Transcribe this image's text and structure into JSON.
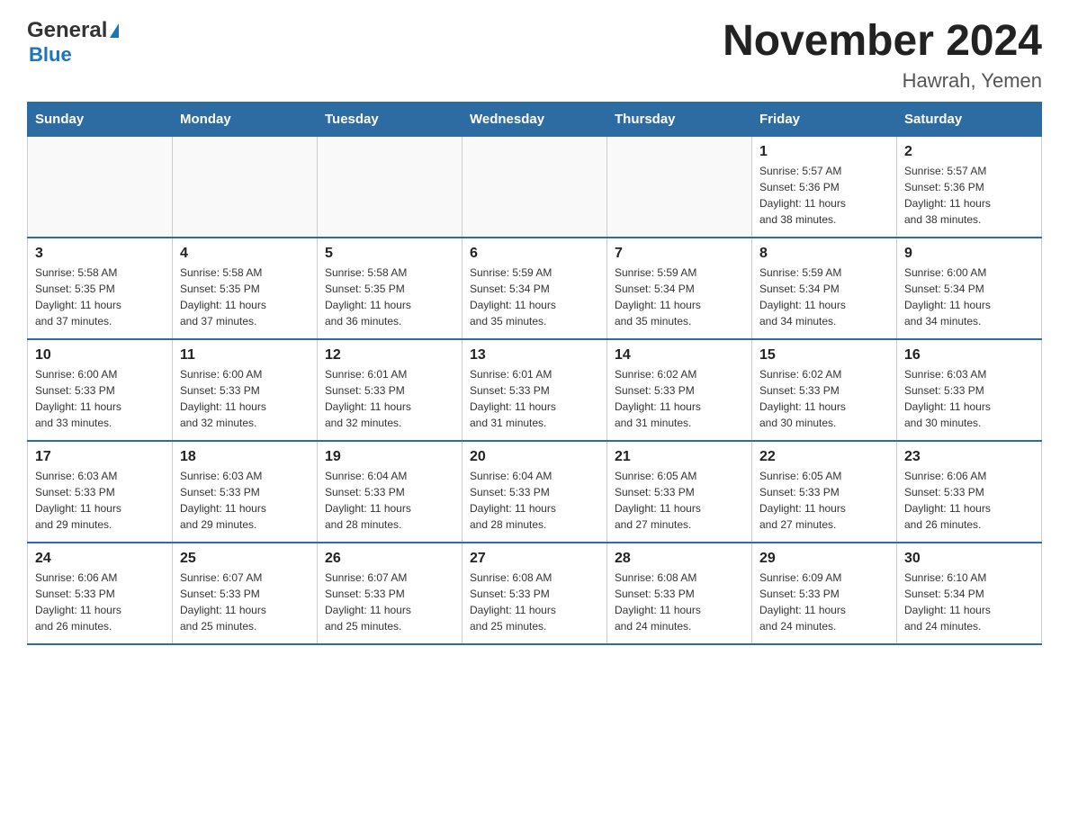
{
  "header": {
    "logo_general": "General",
    "logo_blue": "Blue",
    "title": "November 2024",
    "subtitle": "Hawrah, Yemen"
  },
  "days_header": [
    "Sunday",
    "Monday",
    "Tuesday",
    "Wednesday",
    "Thursday",
    "Friday",
    "Saturday"
  ],
  "weeks": [
    {
      "cells": [
        {
          "day": "",
          "info": ""
        },
        {
          "day": "",
          "info": ""
        },
        {
          "day": "",
          "info": ""
        },
        {
          "day": "",
          "info": ""
        },
        {
          "day": "",
          "info": ""
        },
        {
          "day": "1",
          "info": "Sunrise: 5:57 AM\nSunset: 5:36 PM\nDaylight: 11 hours\nand 38 minutes."
        },
        {
          "day": "2",
          "info": "Sunrise: 5:57 AM\nSunset: 5:36 PM\nDaylight: 11 hours\nand 38 minutes."
        }
      ]
    },
    {
      "cells": [
        {
          "day": "3",
          "info": "Sunrise: 5:58 AM\nSunset: 5:35 PM\nDaylight: 11 hours\nand 37 minutes."
        },
        {
          "day": "4",
          "info": "Sunrise: 5:58 AM\nSunset: 5:35 PM\nDaylight: 11 hours\nand 37 minutes."
        },
        {
          "day": "5",
          "info": "Sunrise: 5:58 AM\nSunset: 5:35 PM\nDaylight: 11 hours\nand 36 minutes."
        },
        {
          "day": "6",
          "info": "Sunrise: 5:59 AM\nSunset: 5:34 PM\nDaylight: 11 hours\nand 35 minutes."
        },
        {
          "day": "7",
          "info": "Sunrise: 5:59 AM\nSunset: 5:34 PM\nDaylight: 11 hours\nand 35 minutes."
        },
        {
          "day": "8",
          "info": "Sunrise: 5:59 AM\nSunset: 5:34 PM\nDaylight: 11 hours\nand 34 minutes."
        },
        {
          "day": "9",
          "info": "Sunrise: 6:00 AM\nSunset: 5:34 PM\nDaylight: 11 hours\nand 34 minutes."
        }
      ]
    },
    {
      "cells": [
        {
          "day": "10",
          "info": "Sunrise: 6:00 AM\nSunset: 5:33 PM\nDaylight: 11 hours\nand 33 minutes."
        },
        {
          "day": "11",
          "info": "Sunrise: 6:00 AM\nSunset: 5:33 PM\nDaylight: 11 hours\nand 32 minutes."
        },
        {
          "day": "12",
          "info": "Sunrise: 6:01 AM\nSunset: 5:33 PM\nDaylight: 11 hours\nand 32 minutes."
        },
        {
          "day": "13",
          "info": "Sunrise: 6:01 AM\nSunset: 5:33 PM\nDaylight: 11 hours\nand 31 minutes."
        },
        {
          "day": "14",
          "info": "Sunrise: 6:02 AM\nSunset: 5:33 PM\nDaylight: 11 hours\nand 31 minutes."
        },
        {
          "day": "15",
          "info": "Sunrise: 6:02 AM\nSunset: 5:33 PM\nDaylight: 11 hours\nand 30 minutes."
        },
        {
          "day": "16",
          "info": "Sunrise: 6:03 AM\nSunset: 5:33 PM\nDaylight: 11 hours\nand 30 minutes."
        }
      ]
    },
    {
      "cells": [
        {
          "day": "17",
          "info": "Sunrise: 6:03 AM\nSunset: 5:33 PM\nDaylight: 11 hours\nand 29 minutes."
        },
        {
          "day": "18",
          "info": "Sunrise: 6:03 AM\nSunset: 5:33 PM\nDaylight: 11 hours\nand 29 minutes."
        },
        {
          "day": "19",
          "info": "Sunrise: 6:04 AM\nSunset: 5:33 PM\nDaylight: 11 hours\nand 28 minutes."
        },
        {
          "day": "20",
          "info": "Sunrise: 6:04 AM\nSunset: 5:33 PM\nDaylight: 11 hours\nand 28 minutes."
        },
        {
          "day": "21",
          "info": "Sunrise: 6:05 AM\nSunset: 5:33 PM\nDaylight: 11 hours\nand 27 minutes."
        },
        {
          "day": "22",
          "info": "Sunrise: 6:05 AM\nSunset: 5:33 PM\nDaylight: 11 hours\nand 27 minutes."
        },
        {
          "day": "23",
          "info": "Sunrise: 6:06 AM\nSunset: 5:33 PM\nDaylight: 11 hours\nand 26 minutes."
        }
      ]
    },
    {
      "cells": [
        {
          "day": "24",
          "info": "Sunrise: 6:06 AM\nSunset: 5:33 PM\nDaylight: 11 hours\nand 26 minutes."
        },
        {
          "day": "25",
          "info": "Sunrise: 6:07 AM\nSunset: 5:33 PM\nDaylight: 11 hours\nand 25 minutes."
        },
        {
          "day": "26",
          "info": "Sunrise: 6:07 AM\nSunset: 5:33 PM\nDaylight: 11 hours\nand 25 minutes."
        },
        {
          "day": "27",
          "info": "Sunrise: 6:08 AM\nSunset: 5:33 PM\nDaylight: 11 hours\nand 25 minutes."
        },
        {
          "day": "28",
          "info": "Sunrise: 6:08 AM\nSunset: 5:33 PM\nDaylight: 11 hours\nand 24 minutes."
        },
        {
          "day": "29",
          "info": "Sunrise: 6:09 AM\nSunset: 5:33 PM\nDaylight: 11 hours\nand 24 minutes."
        },
        {
          "day": "30",
          "info": "Sunrise: 6:10 AM\nSunset: 5:34 PM\nDaylight: 11 hours\nand 24 minutes."
        }
      ]
    }
  ]
}
